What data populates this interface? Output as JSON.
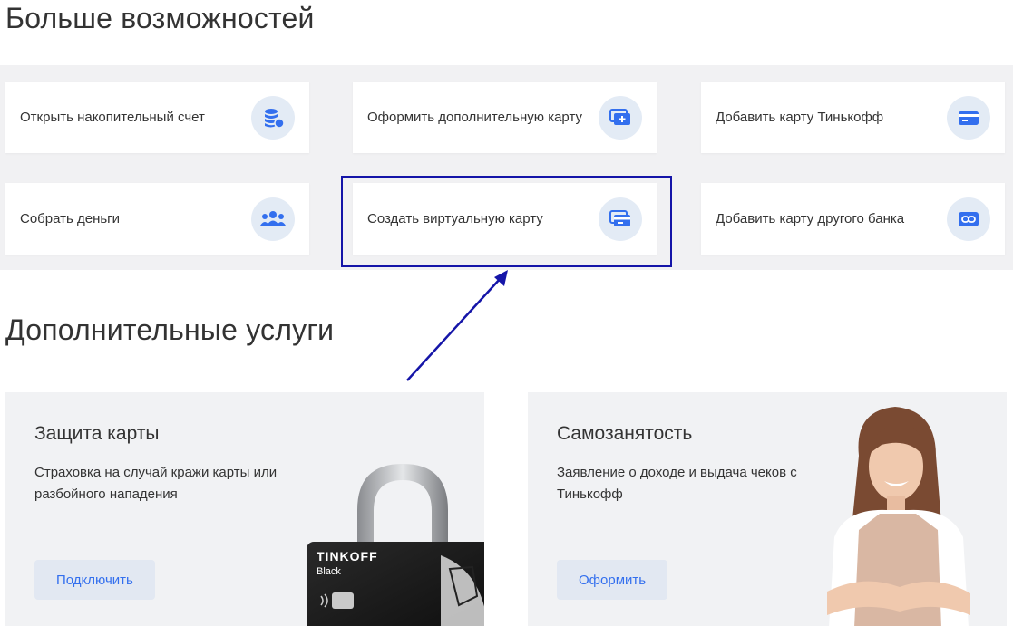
{
  "sections": {
    "more_title": "Больше возможностей",
    "services_title": "Дополнительные услуги"
  },
  "tiles": [
    {
      "label": "Открыть накопительный счет",
      "icon": "coins-stack-icon"
    },
    {
      "label": "Оформить дополнительную карту",
      "icon": "add-card-icon"
    },
    {
      "label": "Добавить карту Тинькофф",
      "icon": "card-icon"
    },
    {
      "label": "Собрать деньги",
      "icon": "people-group-icon"
    },
    {
      "label": "Создать виртуальную карту",
      "icon": "virtual-card-icon"
    },
    {
      "label": "Добавить карту другого банка",
      "icon": "link-icon"
    }
  ],
  "cards": {
    "protection": {
      "title": "Защита карты",
      "description": "Страховка на случай кражи карты или разбойного нападения",
      "button": "Подключить",
      "card_brand": "TINKOFF",
      "card_type": "Black"
    },
    "selfemployed": {
      "title": "Самозанятость",
      "description": "Заявление о доходе и выдача чеков с Тинькофф",
      "button": "Оформить"
    }
  },
  "colors": {
    "accent": "#336fee",
    "icon_bg": "#e3ebf5",
    "section_bg": "#f1f1f3",
    "highlight": "#1515a8"
  }
}
